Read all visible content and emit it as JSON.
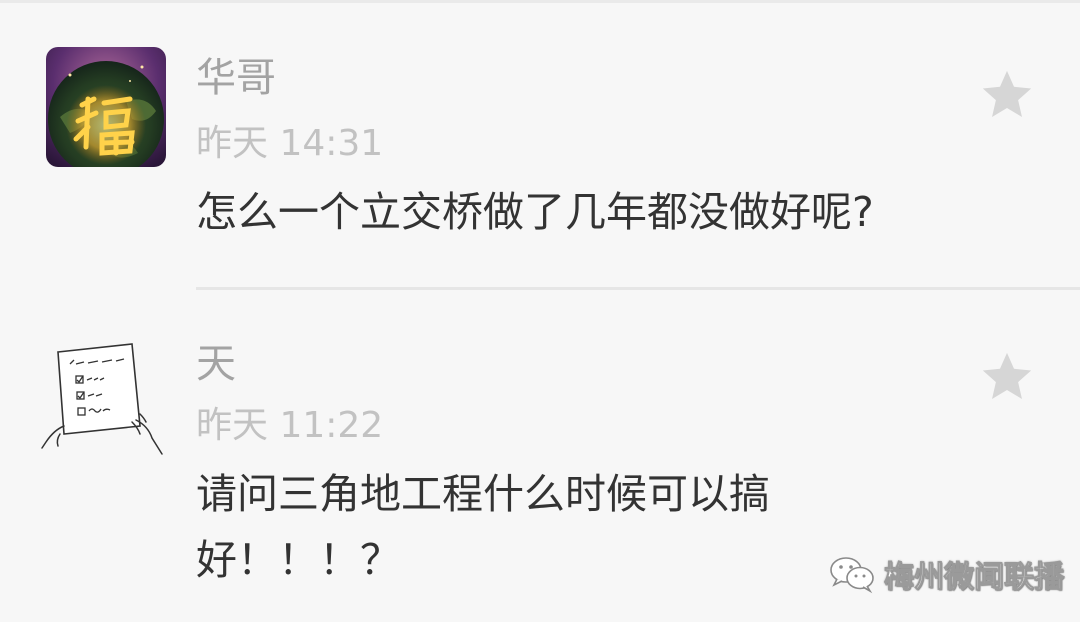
{
  "comments": [
    {
      "nickname": "华哥",
      "time": "昨天 14:31",
      "content": "怎么一个立交桥做了几年都没做好呢?",
      "avatar_icon": "fu-character-avatar"
    },
    {
      "nickname": "天",
      "time": "昨天 11:22",
      "content_line1": "请问三角地工程什么时候可以搞",
      "content_line2": "好！！！？",
      "avatar_icon": "sketch-checklist-avatar"
    }
  ],
  "watermark": {
    "label": "梅州微闻联播",
    "icon": "wechat-icon"
  },
  "colors": {
    "background": "#f7f7f7",
    "nickname": "#a3a3a3",
    "time": "#c2c2c2",
    "content": "#333333",
    "star": "#d6d6d6"
  }
}
